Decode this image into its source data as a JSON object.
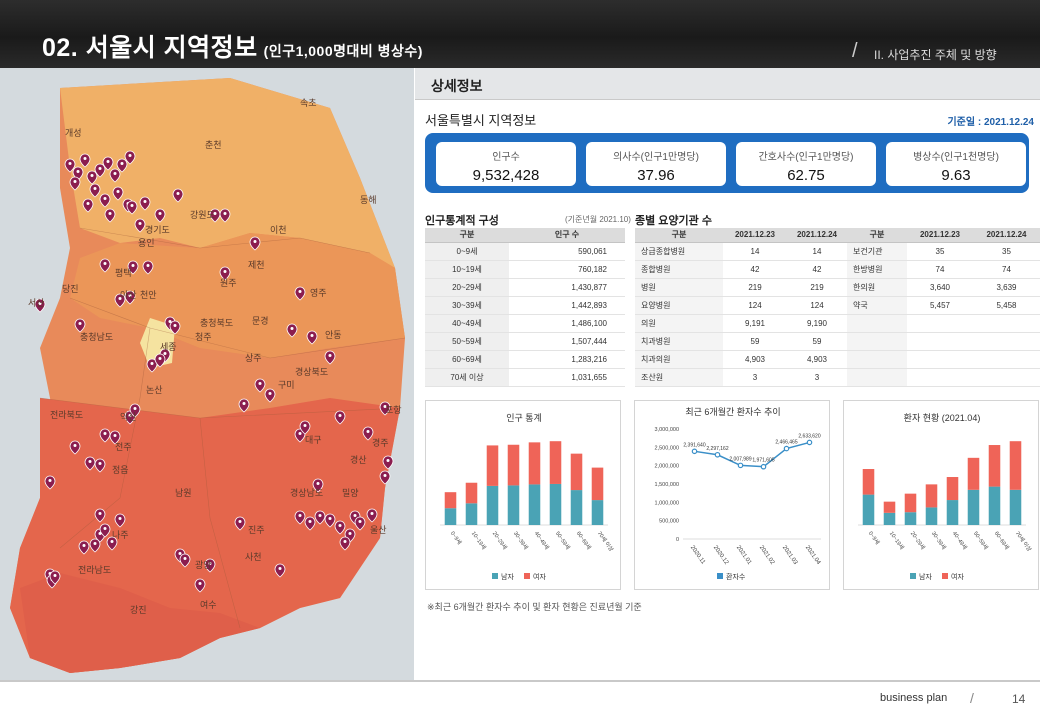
{
  "header": {
    "title": "02. 서울시 지역정보",
    "subtitle": "(인구1,000명대비 병상수)",
    "breadcrumb": "II. 사업추진 주체 및 방향"
  },
  "map": {
    "labels": [
      "속초",
      "개성",
      "동해",
      "서산",
      "당진",
      "천안",
      "충청남도",
      "세종",
      "청주",
      "충청북도",
      "제천",
      "문경",
      "영주",
      "안동",
      "상주",
      "경상북도",
      "구미",
      "익산",
      "전라북도",
      "전주",
      "정읍",
      "대구",
      "경주",
      "포항",
      "경산",
      "밀양",
      "진주",
      "경상남도",
      "나주",
      "전라남도",
      "광양",
      "사천",
      "여수",
      "울산",
      "남원",
      "강진",
      "논산",
      "경기도",
      "강원도",
      "원주",
      "춘천",
      "이천",
      "용인",
      "평택",
      "아산"
    ],
    "pin_color": "#8b1d4f"
  },
  "panel": {
    "title": "상세정보",
    "section": "서울특별시 지역정보",
    "ref_date": "기준일 : 2021.12.24",
    "summary": [
      {
        "label": "인구수",
        "value": "9,532,428"
      },
      {
        "label": "의사수(인구1만명당)",
        "value": "37.96"
      },
      {
        "label": "간호사수(인구1만명당)",
        "value": "62.75"
      },
      {
        "label": "병상수(인구1천명당)",
        "value": "9.63"
      }
    ],
    "pop_table": {
      "title": "인구통계적 구성",
      "note": "(기준년월 2021.10)",
      "headers": [
        "구분",
        "인구 수"
      ],
      "rows": [
        [
          "0~9세",
          "590,061"
        ],
        [
          "10~19세",
          "760,182"
        ],
        [
          "20~29세",
          "1,430,877"
        ],
        [
          "30~39세",
          "1,442,893"
        ],
        [
          "40~49세",
          "1,486,100"
        ],
        [
          "50~59세",
          "1,507,444"
        ],
        [
          "60~69세",
          "1,283,216"
        ],
        [
          "70세 이상",
          "1,031,655"
        ]
      ]
    },
    "inst_table": {
      "title": "종별 요양기관 수",
      "headers": [
        "구분",
        "2021.12.23",
        "2021.12.24",
        "구분",
        "2021.12.23",
        "2021.12.24"
      ],
      "rows": [
        [
          "상급종합병원",
          "14",
          "14",
          "보건기관",
          "35",
          "35"
        ],
        [
          "종합병원",
          "42",
          "42",
          "한방병원",
          "74",
          "74"
        ],
        [
          "병원",
          "219",
          "219",
          "한의원",
          "3,640",
          "3,639"
        ],
        [
          "요양병원",
          "124",
          "124",
          "약국",
          "5,457",
          "5,458"
        ],
        [
          "의원",
          "9,191",
          "9,190",
          "",
          "",
          ""
        ],
        [
          "치과병원",
          "59",
          "59",
          "",
          "",
          ""
        ],
        [
          "치과의원",
          "4,903",
          "4,903",
          "",
          "",
          ""
        ],
        [
          "조산원",
          "3",
          "3",
          "",
          "",
          ""
        ]
      ]
    },
    "note": "※최근 6개월간 환자수 추이 및 환자 현황은 진료년월 기준"
  },
  "footer": {
    "label": "business plan",
    "page": "14"
  },
  "chart_data": [
    {
      "type": "bar",
      "stacked": true,
      "title": "인구 통계",
      "categories": [
        "0~9세",
        "10~19세",
        "20~29세",
        "30~39세",
        "40~49세",
        "50~59세",
        "60~69세",
        "70세 이상"
      ],
      "series": [
        {
          "name": "남자",
          "color": "#4aa3b5",
          "values": [
            302,
            390,
            703,
            712,
            730,
            738,
            628,
            448
          ]
        },
        {
          "name": "여자",
          "color": "#ef6458",
          "values": [
            288,
            370,
            728,
            731,
            756,
            769,
            655,
            584
          ]
        }
      ],
      "legend": "bottom"
    },
    {
      "type": "line",
      "title": "최근 6개월간 환자수 추이",
      "categories": [
        "2020.11",
        "2020.12",
        "2021.01",
        "2021.02",
        "2021.03",
        "2021.04"
      ],
      "series": [
        {
          "name": "환자수",
          "color": "#3a8fc8",
          "values": [
            2391640,
            2297162,
            2007989,
            1971605,
            2466465,
            2633620
          ]
        }
      ],
      "data_labels": [
        "2,391,640",
        "2,297,162",
        "2,007,989",
        "1,971,605",
        "2,466,465",
        "2,633,620"
      ],
      "yticks": [
        "3,000,000",
        "2,500,000",
        "2,000,000",
        "1,500,000",
        "1,000,000",
        "500,000",
        "0"
      ],
      "ylim": [
        0,
        3000000
      ],
      "legend": "bottom"
    },
    {
      "type": "bar",
      "stacked": true,
      "title": "환자 현황 (2021.04)",
      "categories": [
        "0~9세",
        "10~19세",
        "20~29세",
        "30~39세",
        "40~49세",
        "50~59세",
        "60~69세",
        "70세 이상"
      ],
      "series": [
        {
          "name": "남자",
          "color": "#4aa3b5",
          "values": [
            95,
            38,
            40,
            55,
            78,
            110,
            120,
            110
          ]
        },
        {
          "name": "여자",
          "color": "#ef6458",
          "values": [
            80,
            35,
            58,
            72,
            72,
            100,
            130,
            152
          ]
        }
      ],
      "legend": "bottom"
    }
  ]
}
